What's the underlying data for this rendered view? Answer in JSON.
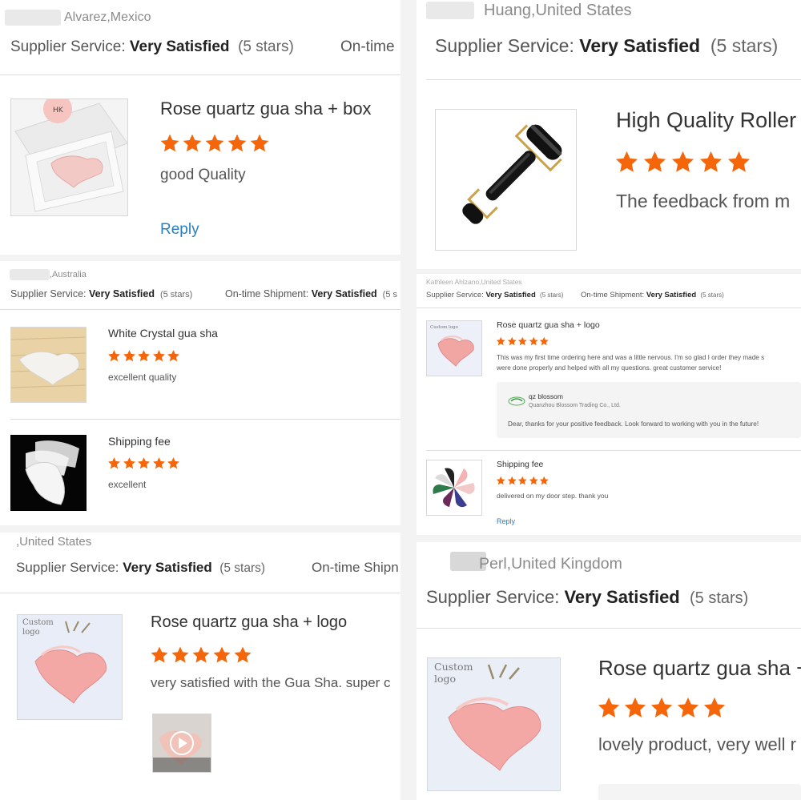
{
  "colors": {
    "star": "#f5660a",
    "link": "#2a7fbf"
  },
  "panel_a": {
    "location": "Alvarez,Mexico",
    "service_label": "Supplier Service:",
    "service_value": "Very Satisfied",
    "service_stars": "(5 stars)",
    "ontime_label": "On-time",
    "review": {
      "title": "Rose quartz gua sha + box",
      "rating": 5,
      "text": "good Quality",
      "reply": "Reply",
      "image_icon": "gua-sha-box-image"
    }
  },
  "panel_b": {
    "location": "Huang,United States",
    "service_label": "Supplier Service:",
    "service_value": "Very Satisfied",
    "service_stars": "(5 stars)",
    "review": {
      "title": "High Quality Roller",
      "rating": 5,
      "text": "The feedback from m",
      "image_icon": "jade-roller-image"
    }
  },
  "panel_c": {
    "location": ",Australia",
    "service_label": "Supplier Service:",
    "service_value": "Very Satisfied",
    "service_stars": "(5 stars)",
    "ontime_label": "On-time Shipment:",
    "ontime_value": "Very Satisfied",
    "ontime_stars": "(5 s",
    "reviews": [
      {
        "title": "White Crystal gua sha",
        "rating": 5,
        "text": "excellent quality"
      },
      {
        "title": "Shipping fee",
        "rating": 5,
        "text": "excellent"
      }
    ]
  },
  "panel_d": {
    "location": "Kathleen Ahlzano,United States",
    "service_label": "Supplier Service:",
    "service_value": "Very Satisfied",
    "service_stars": "(5 stars)",
    "ontime_label": "On-time Shipment:",
    "ontime_value": "Very Satisfied",
    "ontime_stars": "(5 stars)",
    "review1": {
      "title": "Rose quartz gua sha + logo",
      "rating": 5,
      "text_line1": "This was my first time ordering here and was a little nervous. I'm so glad I order they made s",
      "text_line2": "were done properly and helped with all my questions. great customer service!",
      "image_caption": "Custom logo",
      "seller_reply": {
        "name": "qz blossom",
        "company": "Quanzhou Blossom Trading Co., Ltd.",
        "message": "Dear, thanks for your positive feedback. Look forward to working with you in the future!"
      }
    },
    "review2": {
      "title": "Shipping fee",
      "rating": 5,
      "text": "delivered on my door step. thank you",
      "reply": "Reply"
    }
  },
  "panel_e": {
    "location": ",United States",
    "service_label": "Supplier Service:",
    "service_value": "Very Satisfied",
    "service_stars": "(5 stars)",
    "ontime_label": "On-time Shipn",
    "review": {
      "title": "Rose quartz gua sha + logo",
      "rating": 5,
      "text": "very satisfied with the Gua Sha. super c",
      "image_caption": "Custom logo"
    }
  },
  "panel_f": {
    "location": "Perl,United Kingdom",
    "service_label": "Supplier Service:",
    "service_value": "Very Satisfied",
    "service_stars": "(5 stars)",
    "review": {
      "title": "Rose quartz gua sha +",
      "rating": 5,
      "text": "lovely product, very well r",
      "image_caption": "Custom logo"
    }
  }
}
